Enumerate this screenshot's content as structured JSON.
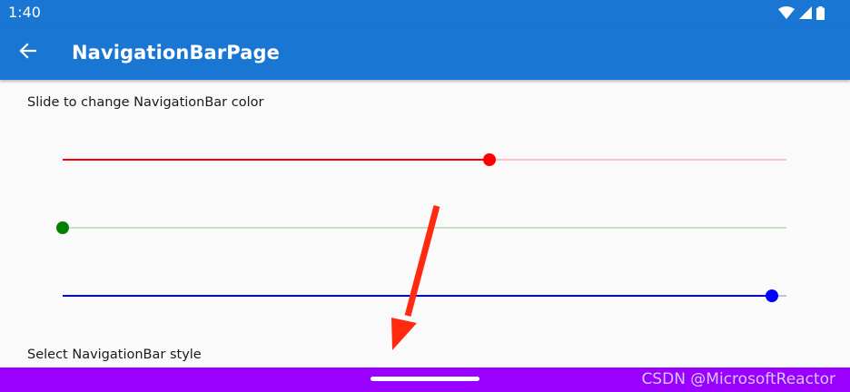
{
  "status_bar": {
    "time": "1:40",
    "icons": [
      "wifi-icon",
      "cell-signal-icon",
      "battery-icon"
    ]
  },
  "app_bar": {
    "back_icon": "arrow-left-icon",
    "title": "NavigationBarPage",
    "background_color": "#1976d2"
  },
  "content": {
    "instruction": "Slide to change NavigationBar color",
    "section_label": "Select NavigationBar style",
    "sliders": [
      {
        "name": "red",
        "value": 0.59,
        "color": "#ff0000",
        "track_color": "#ffc2c2"
      },
      {
        "name": "green",
        "value": 0.0,
        "color": "#008000",
        "track_color": "#c4e2c4"
      },
      {
        "name": "blue",
        "value": 0.98,
        "color": "#0000ff",
        "track_color": "#b6c2f5"
      }
    ]
  },
  "annotation": {
    "arrow_color": "#ff2a10"
  },
  "nav_bar": {
    "background_color": "#9900ff",
    "watermark": "CSDN @MicrosoftReactor"
  }
}
